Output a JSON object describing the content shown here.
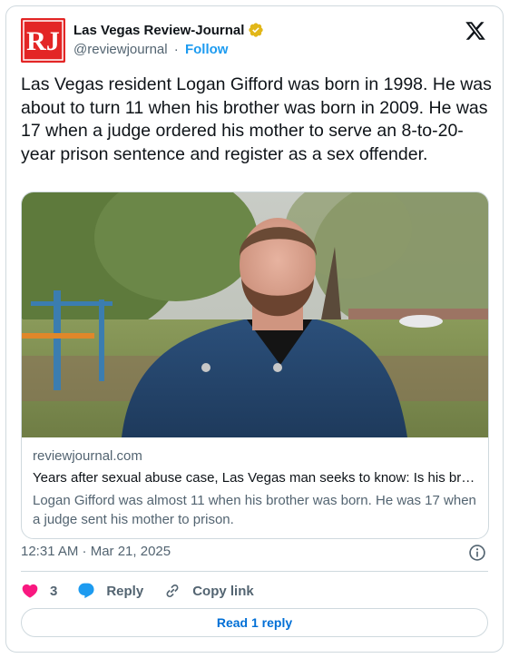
{
  "account": {
    "avatar_text": "RJ",
    "name": "Las Vegas Review-Journal",
    "handle": "@reviewjournal",
    "separator": "·",
    "follow_label": "Follow",
    "verified_color": "#e2b719",
    "brand_color": "#e32525"
  },
  "tweet": {
    "text": "Las Vegas resident Logan Gifford was born in 1998. He was about to turn 11 when his brother was born in 2009. He was 17 when a judge ordered his mother to serve an 8-to-20-year prison sentence and register as a sex offender."
  },
  "link_card": {
    "domain": "reviewjournal.com",
    "title": "Years after sexual abuse case, Las Vegas man seeks to know: Is his broth…",
    "description": "Logan Gifford was almost 11 when his brother was born. He was 17 when a judge sent his mother to prison."
  },
  "meta": {
    "timestamp": "12:31 AM · Mar 21, 2025"
  },
  "actions": {
    "like_count": "3",
    "reply_label": "Reply",
    "copy_link_label": "Copy link",
    "read_replies_label": "Read 1 reply"
  },
  "colors": {
    "accent": "#1d9bf0",
    "like": "#f91880",
    "muted_text": "#536471"
  },
  "icons": [
    "verified-badge-icon",
    "x-logo-icon",
    "info-icon",
    "heart-icon",
    "reply-bubble-icon",
    "link-icon"
  ]
}
